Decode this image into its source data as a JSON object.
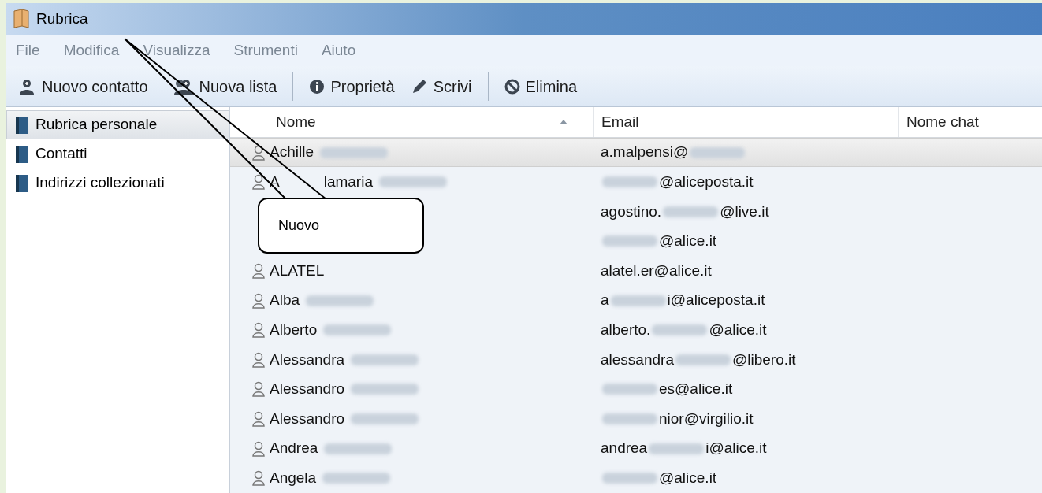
{
  "window": {
    "title": "Rubrica"
  },
  "menu": [
    "File",
    "Modifica",
    "Visualizza",
    "Strumenti",
    "Aiuto"
  ],
  "toolbar": [
    {
      "kind": "add-contact",
      "label": "Nuovo contatto"
    },
    {
      "kind": "add-list",
      "label": "Nuova lista"
    },
    {
      "kind": "separator"
    },
    {
      "kind": "info",
      "label": "Proprietà"
    },
    {
      "kind": "pencil",
      "label": "Scrivi"
    },
    {
      "kind": "separator"
    },
    {
      "kind": "delete",
      "label": "Elimina"
    }
  ],
  "sidebar": {
    "items": [
      {
        "label": "Rubrica personale",
        "selected": true
      },
      {
        "label": "Contatti",
        "selected": false
      },
      {
        "label": "Indirizzi collezionati",
        "selected": false
      }
    ]
  },
  "table": {
    "columns": [
      {
        "label": "Nome",
        "sorted": true
      },
      {
        "label": "Email",
        "sorted": false
      },
      {
        "label": "Nome chat",
        "sorted": false
      }
    ],
    "rows": [
      {
        "selected": true,
        "name": [
          "Achille"
        ],
        "surname_blurred": true,
        "email_before": "a.malpensi@",
        "email_blurred": true
      },
      {
        "selected": false,
        "name": [
          "A",
          "lamaria"
        ],
        "surname_blurred": true,
        "email_blurred": true,
        "email_after": "@aliceposta.it"
      },
      {
        "selected": false,
        "name": [],
        "surname_blurred": false,
        "email_before": "agostino.",
        "email_blurred": true,
        "email_after": "@live.it"
      },
      {
        "selected": false,
        "name": [],
        "surname_blurred": false,
        "email_blurred": true,
        "email_after": "@alice.it"
      },
      {
        "selected": false,
        "name": [
          "ALATEL"
        ],
        "surname_blurred": false,
        "email_before": "alatel.er@alice.it",
        "email_blurred": false
      },
      {
        "selected": false,
        "name": [
          "Alba"
        ],
        "surname_blurred": true,
        "email_before": "a",
        "email_blurred": true,
        "email_after": "i@aliceposta.it"
      },
      {
        "selected": false,
        "name": [
          "Alberto"
        ],
        "surname_blurred": true,
        "email_before": "alberto.",
        "email_blurred": true,
        "email_after": "@alice.it"
      },
      {
        "selected": false,
        "name": [
          "Alessandra"
        ],
        "surname_blurred": true,
        "email_before": "alessandra",
        "email_blurred": true,
        "email_after": "@libero.it"
      },
      {
        "selected": false,
        "name": [
          "Alessandro"
        ],
        "surname_blurred": true,
        "email_blurred": true,
        "email_after": "es@alice.it"
      },
      {
        "selected": false,
        "name": [
          "Alessandro"
        ],
        "surname_blurred": true,
        "email_blurred": true,
        "email_after": "nior@virgilio.it"
      },
      {
        "selected": false,
        "name": [
          "Andrea"
        ],
        "surname_blurred": true,
        "email_before": "andrea",
        "email_blurred": true,
        "email_after": "i@alice.it"
      },
      {
        "selected": false,
        "name": [
          "Angela"
        ],
        "surname_blurred": true,
        "email_blurred": true,
        "email_after": "@alice.it"
      }
    ]
  },
  "callout": {
    "text": "Nuovo"
  }
}
